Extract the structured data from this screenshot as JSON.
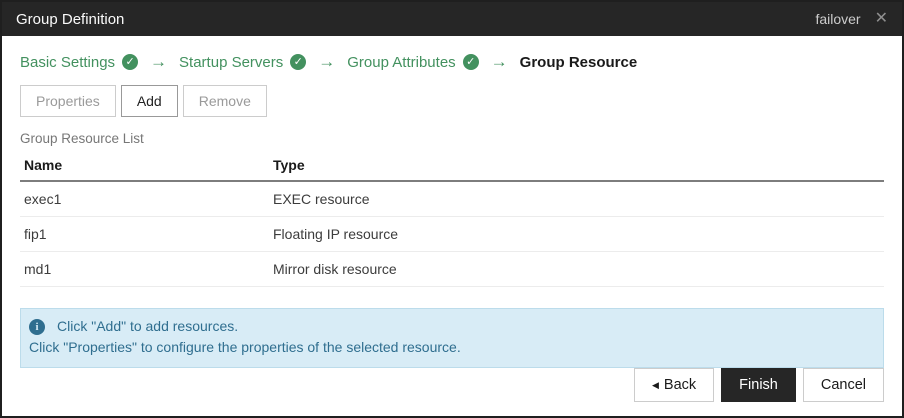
{
  "window": {
    "title": "Group Definition",
    "context_label": "failover"
  },
  "icons": {
    "close": "✕",
    "check": "✓",
    "arrow": "→",
    "back_triangle": "◀",
    "info": "i"
  },
  "wizard": {
    "steps": [
      {
        "label": "Basic Settings",
        "completed": true,
        "current": false
      },
      {
        "label": "Startup Servers",
        "completed": true,
        "current": false
      },
      {
        "label": "Group Attributes",
        "completed": true,
        "current": false
      },
      {
        "label": "Group Resource",
        "completed": false,
        "current": true
      }
    ]
  },
  "toolbar": {
    "properties_label": "Properties",
    "add_label": "Add",
    "remove_label": "Remove"
  },
  "list": {
    "caption": "Group Resource List",
    "columns": [
      "Name",
      "Type"
    ],
    "rows": [
      {
        "name": "exec1",
        "type": "EXEC resource"
      },
      {
        "name": "fip1",
        "type": "Floating IP resource"
      },
      {
        "name": "md1",
        "type": "Mirror disk resource"
      }
    ]
  },
  "info": {
    "line1": "Click \"Add\" to add resources.",
    "line2": "Click \"Properties\" to configure the properties of the selected resource."
  },
  "footer": {
    "back_label": "Back",
    "finish_label": "Finish",
    "cancel_label": "Cancel"
  },
  "colors": {
    "accent_green": "#43915f",
    "header_bg": "#262626",
    "info_bg": "#d8ecf6",
    "info_text": "#2f6e8f"
  }
}
